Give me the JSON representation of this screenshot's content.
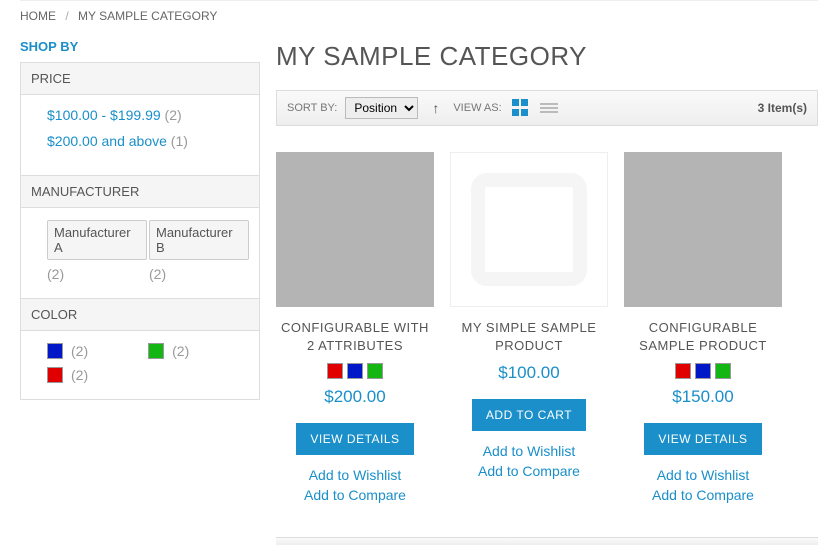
{
  "breadcrumb": {
    "home": "HOME",
    "current": "MY SAMPLE CATEGORY"
  },
  "sidebar": {
    "title": "SHOP BY",
    "price": {
      "header": "PRICE",
      "items": [
        {
          "label": "$100.00 - $199.99",
          "count": "(2)"
        },
        {
          "label": "$200.00 and above",
          "count": "(1)"
        }
      ]
    },
    "manufacturer": {
      "header": "MANUFACTURER",
      "items": [
        {
          "label": "Manufacturer A",
          "count": "(2)"
        },
        {
          "label": "Manufacturer B",
          "count": "(2)"
        }
      ]
    },
    "color": {
      "header": "COLOR",
      "items": [
        {
          "hex": "#0018c8",
          "count": "(2)"
        },
        {
          "hex": "#14b614",
          "count": "(2)"
        },
        {
          "hex": "#e00000",
          "count": "(2)"
        }
      ]
    }
  },
  "main": {
    "title": "MY SAMPLE CATEGORY",
    "toolbar": {
      "sort_by": "SORT BY:",
      "sort_value": "Position",
      "view_as": "VIEW AS:",
      "count": "3 Item(s)"
    },
    "products": [
      {
        "name": "CONFIGURABLE WITH 2 ATTRIBUTES",
        "swatches": [
          "#e00000",
          "#0018c8",
          "#14b614"
        ],
        "price": "$200.00",
        "button": "VIEW DETAILS",
        "placeholder": false
      },
      {
        "name": "MY SIMPLE SAMPLE PRODUCT",
        "swatches": [],
        "price": "$100.00",
        "button": "ADD TO CART",
        "placeholder": true
      },
      {
        "name": "CONFIGURABLE SAMPLE PRODUCT",
        "swatches": [
          "#e00000",
          "#0018c8",
          "#14b614"
        ],
        "price": "$150.00",
        "button": "VIEW DETAILS",
        "placeholder": false
      }
    ],
    "wishlist": "Add to Wishlist",
    "compare": "Add to Compare"
  }
}
